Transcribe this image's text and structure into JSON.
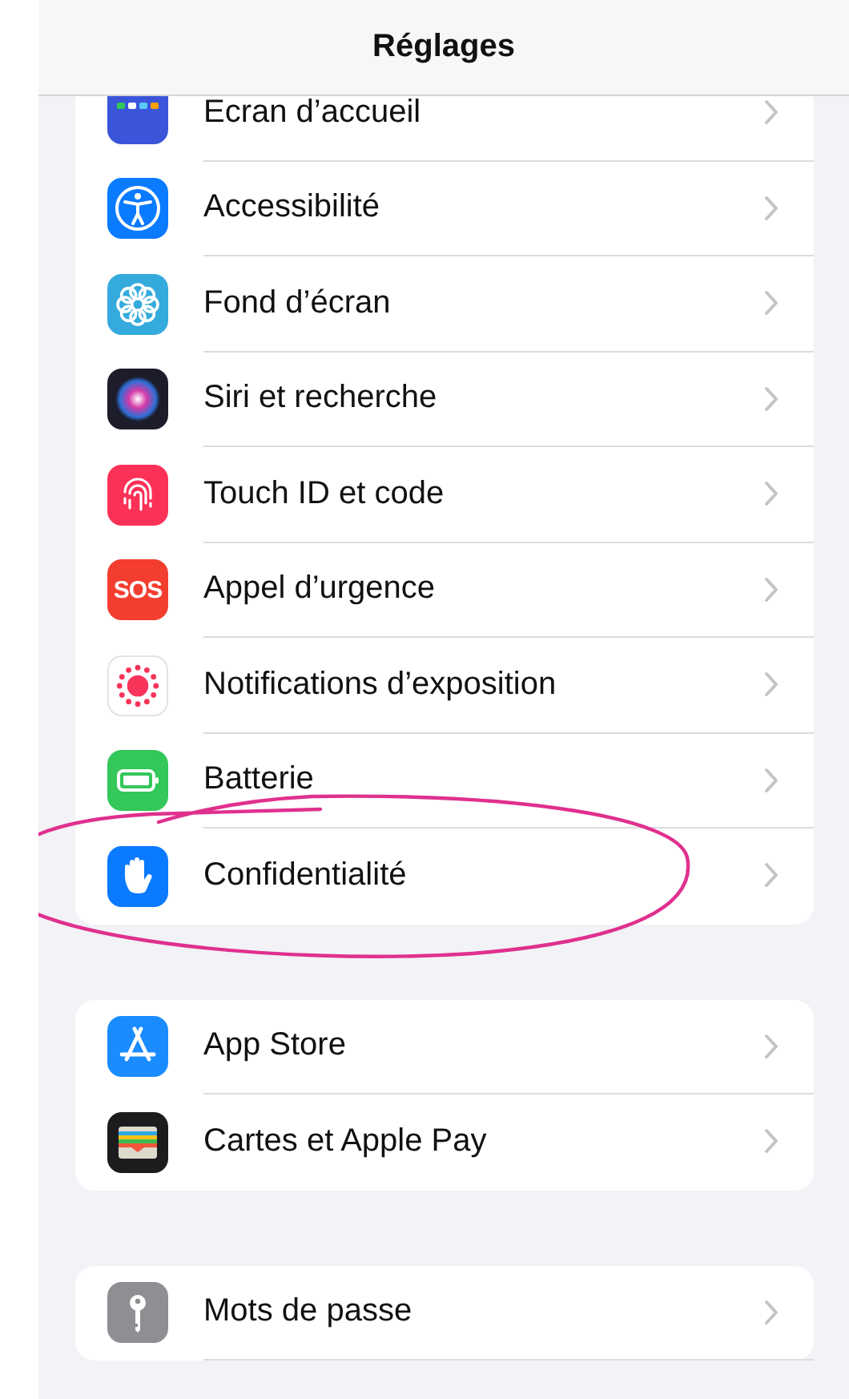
{
  "navigation_bar": {
    "title": "Réglages"
  },
  "groups": [
    {
      "items": [
        {
          "label": "Ecran d’accueil",
          "kind": "home",
          "circled": false
        },
        {
          "label": "Accessibilité",
          "kind": "accessibility",
          "circled": false
        },
        {
          "label": "Fond d’écran",
          "kind": "wallpaper",
          "circled": false
        },
        {
          "label": "Siri et recherche",
          "kind": "siri",
          "circled": false
        },
        {
          "label": "Touch ID et code",
          "kind": "fingerprint",
          "circled": false
        },
        {
          "label": "Appel d’urgence",
          "kind": "sos",
          "icon_text": "SOS",
          "circled": false
        },
        {
          "label": "Notifications d’exposition",
          "kind": "exposure",
          "circled": false
        },
        {
          "label": "Batterie",
          "kind": "battery",
          "circled": false
        },
        {
          "label": "Confidentialité",
          "kind": "privacy",
          "circled": true
        }
      ]
    },
    {
      "items": [
        {
          "label": "App Store",
          "kind": "appstore",
          "circled": false
        },
        {
          "label": "Cartes et Apple Pay",
          "kind": "wallet",
          "circled": false
        }
      ]
    },
    {
      "items": [
        {
          "label": "Mots de passe",
          "kind": "key",
          "circled": false
        }
      ]
    }
  ]
}
